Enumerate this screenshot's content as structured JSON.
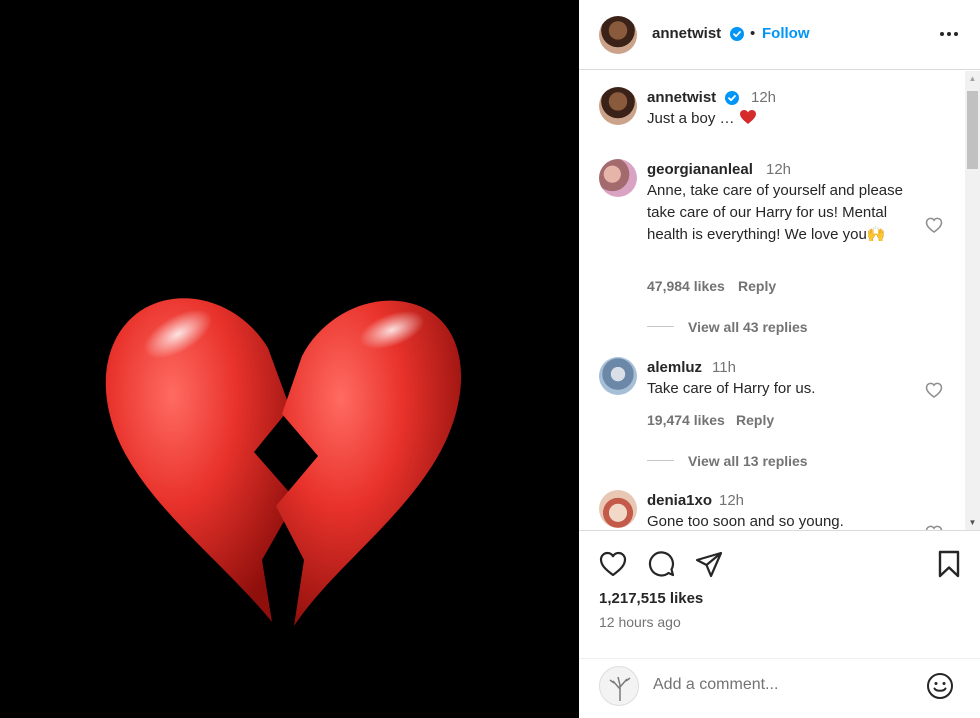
{
  "post": {
    "username": "annetwist",
    "follow_label": "Follow",
    "separator": "•"
  },
  "caption": {
    "username": "annetwist",
    "time": "12h",
    "text": "Just a boy …"
  },
  "comments": [
    {
      "username": "georgiananleal",
      "time": "12h",
      "text": "Anne, take care of yourself and please take care of our Harry for us! Mental health is everything! We love you🙌",
      "likes": "47,984 likes",
      "reply_label": "Reply",
      "view_replies": "View all 43 replies"
    },
    {
      "username": "alemluz",
      "time": "11h",
      "text": "Take care of Harry for us.",
      "likes": "19,474 likes",
      "reply_label": "Reply",
      "view_replies": "View all 13 replies"
    },
    {
      "username": "denia1xo",
      "time": "12h",
      "text": "Gone too soon and so young."
    }
  ],
  "stats": {
    "likes": "1,217,515 likes",
    "posted": "12 hours ago"
  },
  "add_comment": {
    "placeholder": "Add a comment..."
  },
  "icons": {
    "more": "more-options-icon",
    "verified": "verified-badge-icon",
    "like": "heart-outline-icon",
    "comment": "comment-bubble-icon",
    "share": "paper-plane-icon",
    "save": "bookmark-icon",
    "emoji": "smiley-face-icon",
    "media": "broken-heart-emoji"
  },
  "colors": {
    "link_blue": "#0095f6",
    "verified_blue": "#0095f6",
    "media_background": "#000000",
    "heart_red": "#e4332c"
  }
}
